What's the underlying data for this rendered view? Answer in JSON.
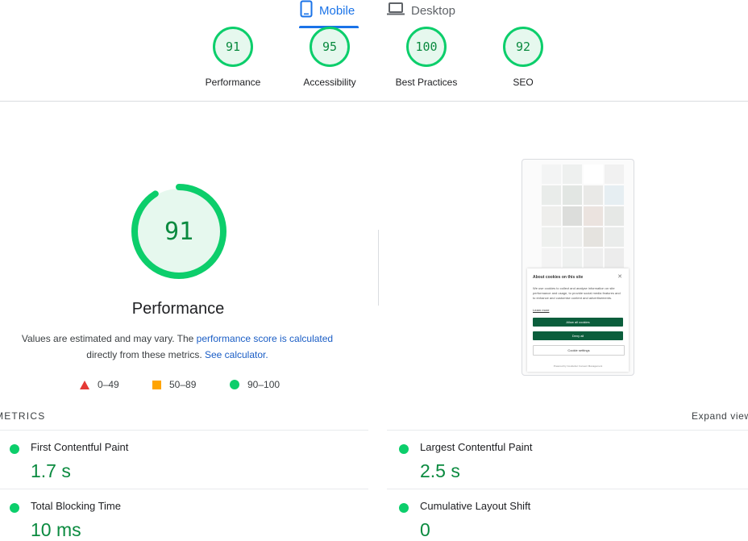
{
  "tabs": {
    "mobile": "Mobile",
    "desktop": "Desktop"
  },
  "scores": [
    {
      "label": "Performance",
      "value": "91"
    },
    {
      "label": "Accessibility",
      "value": "95"
    },
    {
      "label": "Best Practices",
      "value": "100"
    },
    {
      "label": "SEO",
      "value": "92"
    }
  ],
  "main": {
    "score": "91",
    "score_fraction": 0.91,
    "title": "Performance",
    "desc_prefix": "Values are estimated and may vary. The ",
    "desc_link": "performance score is calculated",
    "desc_middle": "directly from these metrics. ",
    "desc_link2": "See calculator."
  },
  "legend": [
    {
      "icon": "triangle-red",
      "label": "0–49"
    },
    {
      "icon": "square-orange",
      "label": "50–89"
    },
    {
      "icon": "circle-green",
      "label": "90–100"
    }
  ],
  "colors": {
    "pass": "#0cce6b",
    "pass_text": "#0a8a3f",
    "average": "#ffa400",
    "fail": "#e53935",
    "link": "#1a5dc5",
    "accent": "#1a73e8"
  },
  "thumbnail": {
    "cookie_title": "About cookies on this site",
    "cookie_body": "We use cookies to collect and analyse information on site performance and usage, to provide social media features and to enhance and customise content and advertisements.",
    "cookie_link": "Learn more",
    "allow_label": "Allow all cookies",
    "deny_label": "Deny all",
    "settings_label": "Cookie settings",
    "footer": "Powered by Cookiebot Consent Management"
  },
  "metrics": {
    "title": "METRICS",
    "expand_label": "Expand view",
    "items": [
      {
        "name": "First Contentful Paint",
        "value": "1.7 s"
      },
      {
        "name": "Largest Contentful Paint",
        "value": "2.5 s"
      },
      {
        "name": "Total Blocking Time",
        "value": "10 ms"
      },
      {
        "name": "Cumulative Layout Shift",
        "value": "0"
      }
    ]
  }
}
